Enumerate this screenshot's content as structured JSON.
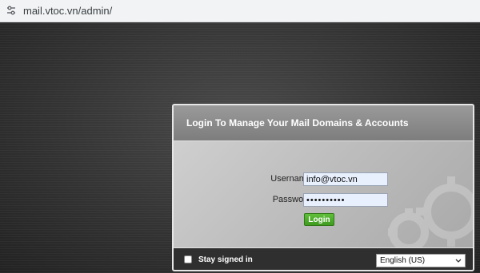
{
  "browser": {
    "url": "mail.vtoc.vn/admin/"
  },
  "login": {
    "title": "Login To Manage Your Mail Domains & Accounts",
    "username_label": "Username",
    "username_value": "info@vtoc.vn",
    "password_label": "Password",
    "password_value": "••••••••••",
    "login_button": "Login",
    "stay_signed_in": "Stay signed in",
    "stay_signed_in_checked": false,
    "language": "English (US)"
  },
  "colors": {
    "login_button": "#4caf2a",
    "footer": "#2f2f2f",
    "header": "#8a8a8a"
  }
}
